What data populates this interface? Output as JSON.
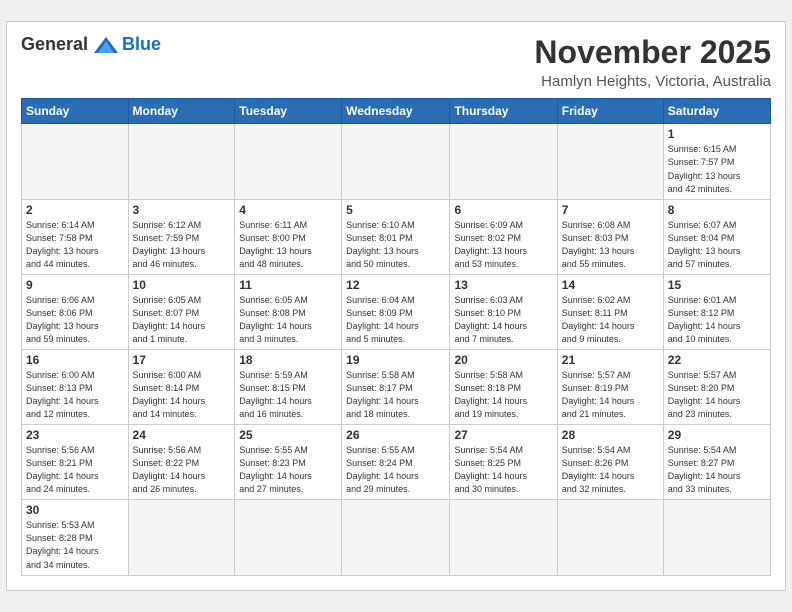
{
  "header": {
    "logo_general": "General",
    "logo_blue": "Blue",
    "month": "November 2025",
    "location": "Hamlyn Heights, Victoria, Australia"
  },
  "days_of_week": [
    "Sunday",
    "Monday",
    "Tuesday",
    "Wednesday",
    "Thursday",
    "Friday",
    "Saturday"
  ],
  "weeks": [
    [
      {
        "day": "",
        "info": ""
      },
      {
        "day": "",
        "info": ""
      },
      {
        "day": "",
        "info": ""
      },
      {
        "day": "",
        "info": ""
      },
      {
        "day": "",
        "info": ""
      },
      {
        "day": "",
        "info": ""
      },
      {
        "day": "1",
        "info": "Sunrise: 6:15 AM\nSunset: 7:57 PM\nDaylight: 13 hours\nand 42 minutes."
      }
    ],
    [
      {
        "day": "2",
        "info": "Sunrise: 6:14 AM\nSunset: 7:58 PM\nDaylight: 13 hours\nand 44 minutes."
      },
      {
        "day": "3",
        "info": "Sunrise: 6:12 AM\nSunset: 7:59 PM\nDaylight: 13 hours\nand 46 minutes."
      },
      {
        "day": "4",
        "info": "Sunrise: 6:11 AM\nSunset: 8:00 PM\nDaylight: 13 hours\nand 48 minutes."
      },
      {
        "day": "5",
        "info": "Sunrise: 6:10 AM\nSunset: 8:01 PM\nDaylight: 13 hours\nand 50 minutes."
      },
      {
        "day": "6",
        "info": "Sunrise: 6:09 AM\nSunset: 8:02 PM\nDaylight: 13 hours\nand 53 minutes."
      },
      {
        "day": "7",
        "info": "Sunrise: 6:08 AM\nSunset: 8:03 PM\nDaylight: 13 hours\nand 55 minutes."
      },
      {
        "day": "8",
        "info": "Sunrise: 6:07 AM\nSunset: 8:04 PM\nDaylight: 13 hours\nand 57 minutes."
      }
    ],
    [
      {
        "day": "9",
        "info": "Sunrise: 6:06 AM\nSunset: 8:06 PM\nDaylight: 13 hours\nand 59 minutes."
      },
      {
        "day": "10",
        "info": "Sunrise: 6:05 AM\nSunset: 8:07 PM\nDaylight: 14 hours\nand 1 minute."
      },
      {
        "day": "11",
        "info": "Sunrise: 6:05 AM\nSunset: 8:08 PM\nDaylight: 14 hours\nand 3 minutes."
      },
      {
        "day": "12",
        "info": "Sunrise: 6:04 AM\nSunset: 8:09 PM\nDaylight: 14 hours\nand 5 minutes."
      },
      {
        "day": "13",
        "info": "Sunrise: 6:03 AM\nSunset: 8:10 PM\nDaylight: 14 hours\nand 7 minutes."
      },
      {
        "day": "14",
        "info": "Sunrise: 6:02 AM\nSunset: 8:11 PM\nDaylight: 14 hours\nand 9 minutes."
      },
      {
        "day": "15",
        "info": "Sunrise: 6:01 AM\nSunset: 8:12 PM\nDaylight: 14 hours\nand 10 minutes."
      }
    ],
    [
      {
        "day": "16",
        "info": "Sunrise: 6:00 AM\nSunset: 8:13 PM\nDaylight: 14 hours\nand 12 minutes."
      },
      {
        "day": "17",
        "info": "Sunrise: 6:00 AM\nSunset: 8:14 PM\nDaylight: 14 hours\nand 14 minutes."
      },
      {
        "day": "18",
        "info": "Sunrise: 5:59 AM\nSunset: 8:15 PM\nDaylight: 14 hours\nand 16 minutes."
      },
      {
        "day": "19",
        "info": "Sunrise: 5:58 AM\nSunset: 8:17 PM\nDaylight: 14 hours\nand 18 minutes."
      },
      {
        "day": "20",
        "info": "Sunrise: 5:58 AM\nSunset: 8:18 PM\nDaylight: 14 hours\nand 19 minutes."
      },
      {
        "day": "21",
        "info": "Sunrise: 5:57 AM\nSunset: 8:19 PM\nDaylight: 14 hours\nand 21 minutes."
      },
      {
        "day": "22",
        "info": "Sunrise: 5:57 AM\nSunset: 8:20 PM\nDaylight: 14 hours\nand 23 minutes."
      }
    ],
    [
      {
        "day": "23",
        "info": "Sunrise: 5:56 AM\nSunset: 8:21 PM\nDaylight: 14 hours\nand 24 minutes."
      },
      {
        "day": "24",
        "info": "Sunrise: 5:56 AM\nSunset: 8:22 PM\nDaylight: 14 hours\nand 26 minutes."
      },
      {
        "day": "25",
        "info": "Sunrise: 5:55 AM\nSunset: 8:23 PM\nDaylight: 14 hours\nand 27 minutes."
      },
      {
        "day": "26",
        "info": "Sunrise: 5:55 AM\nSunset: 8:24 PM\nDaylight: 14 hours\nand 29 minutes."
      },
      {
        "day": "27",
        "info": "Sunrise: 5:54 AM\nSunset: 8:25 PM\nDaylight: 14 hours\nand 30 minutes."
      },
      {
        "day": "28",
        "info": "Sunrise: 5:54 AM\nSunset: 8:26 PM\nDaylight: 14 hours\nand 32 minutes."
      },
      {
        "day": "29",
        "info": "Sunrise: 5:54 AM\nSunset: 8:27 PM\nDaylight: 14 hours\nand 33 minutes."
      }
    ],
    [
      {
        "day": "30",
        "info": "Sunrise: 5:53 AM\nSunset: 8:28 PM\nDaylight: 14 hours\nand 34 minutes."
      },
      {
        "day": "",
        "info": ""
      },
      {
        "day": "",
        "info": ""
      },
      {
        "day": "",
        "info": ""
      },
      {
        "day": "",
        "info": ""
      },
      {
        "day": "",
        "info": ""
      },
      {
        "day": "",
        "info": ""
      }
    ]
  ]
}
